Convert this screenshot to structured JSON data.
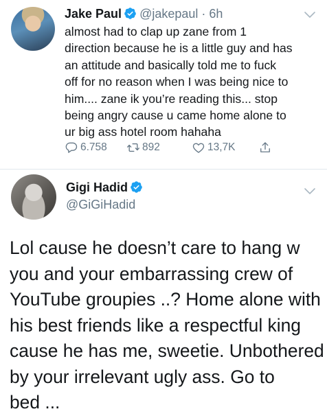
{
  "tweet1": {
    "name": "Jake Paul",
    "handle_time": "@jakepaul · 6h",
    "lines": [
      "almost had to clap up zane from 1",
      "direction because he is a little guy and has",
      "an attitude and basically told me to fuck",
      "off for no reason when I was being nice to",
      "him.... zane ik you’re reading this... stop",
      "being angry cause u came home alone to",
      "ur big ass hotel room hahaha"
    ],
    "replies": "6.758",
    "retweets": "892",
    "likes": "13,7K"
  },
  "tweet2": {
    "name": "Gigi Hadid",
    "handle": "@GiGiHadid",
    "lines": [
      "Lol cause he doesn’t care to hang w",
      "you and your embarrassing crew of",
      "YouTube groupies ..? Home alone with",
      "his best friends like a respectful king",
      "cause he has me, sweetie. Unbothered",
      "by your irrelevant ugly ass. Go to",
      "bed ..."
    ]
  },
  "colors": {
    "verified": "#1da1f2",
    "secondary": "#657786",
    "divider": "#e1e8ed"
  },
  "icons": [
    "verified-badge-icon",
    "chevron-down-icon",
    "reply-icon",
    "retweet-icon",
    "like-icon",
    "share-icon"
  ]
}
